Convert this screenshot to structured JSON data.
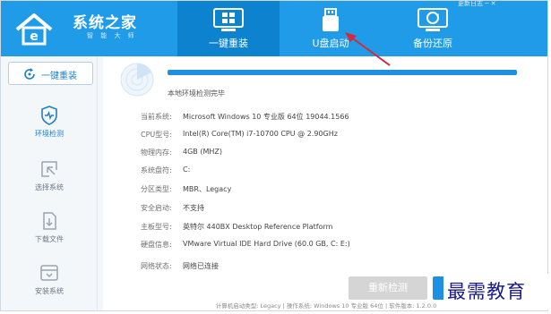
{
  "app": {
    "brand_title": "系统之家",
    "brand_subtitle": "智 能 大 师",
    "window_controls": "更新日志  ─  ✕"
  },
  "tabs": [
    {
      "label": "一键重装",
      "icon": "windows-icon",
      "active": true
    },
    {
      "label": "U盘启动",
      "icon": "usb-drive-icon",
      "active": false
    },
    {
      "label": "备份还原",
      "icon": "backup-restore-icon",
      "active": false
    }
  ],
  "sidebar": {
    "reinstall_label": "一键重装",
    "items": [
      {
        "label": "环境检测",
        "icon": "shield-check-icon",
        "active": true
      },
      {
        "label": "选择系统",
        "icon": "cursor-select-icon",
        "active": false
      },
      {
        "label": "下载文件",
        "icon": "document-icon",
        "active": false
      },
      {
        "label": "安装系统",
        "icon": "install-icon",
        "active": false
      }
    ]
  },
  "detection": {
    "status": "本地环境检测完毕",
    "progress_percent": 100
  },
  "info": [
    {
      "label": "当前系统:",
      "value": "Microsoft Windows 10 专业版 64位 19044.1566"
    },
    {
      "label": "CPU型号:",
      "value": "Intel(R) Core(TM) i7-10700 CPU @ 2.90GHz"
    },
    {
      "label": "物理内存:",
      "value": "4GB (MHZ)"
    },
    {
      "label": "系统盘符:",
      "value": "C:"
    },
    {
      "label": "分区类型:",
      "value": "MBR、Legacy"
    },
    {
      "label": "安全启动:",
      "value": "不支持"
    },
    {
      "label": "主板型号:",
      "value": "英特尔 440BX Desktop Reference Platform"
    },
    {
      "label": "硬盘信息:",
      "value": "VMware Virtual IDE Hard Drive  (60.0 GB, C: E:)"
    },
    {
      "label": "网络状态:",
      "value": "网络已连接"
    }
  ],
  "buttons": {
    "recheck_label": "重新检测",
    "next_label": ""
  },
  "footer": {
    "text": "计算机启动类型: Legacy | 操作系统: Windows 10 专业版 64位 | 软件版本: 1.2.0.0"
  },
  "watermark": {
    "text": "最需教育"
  },
  "colors": {
    "header": "#1f9be8",
    "active_tab": "#0d82cf",
    "accent": "#1f8fe3",
    "arrow": "#d8273a"
  }
}
